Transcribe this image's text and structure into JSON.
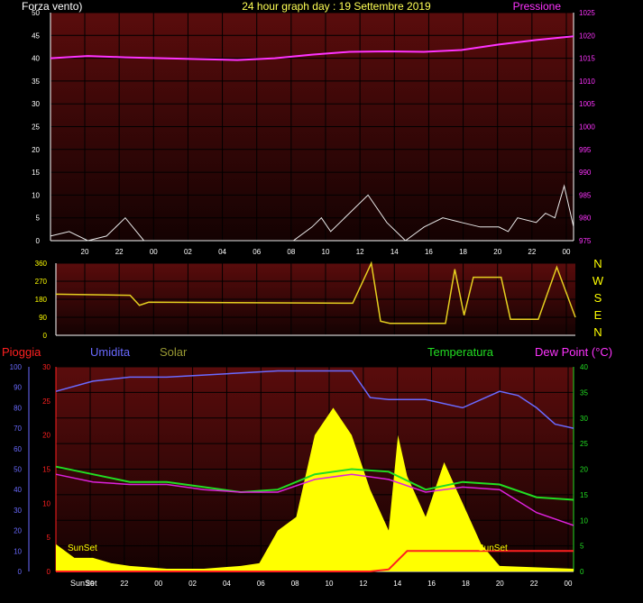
{
  "colors": {
    "bg": "#000000",
    "plot_top": "#5a0c0c",
    "plot_bottom": "#140202",
    "grid": "#000000",
    "axis": "#ffffff",
    "wind": "#e8e8e8",
    "gust": "#ffffff",
    "pressure": "#ff33ff",
    "direction": "#e6d020",
    "rain": "#ff2020",
    "humidity": "#6a6aff",
    "solar": "#ffff00",
    "temperature": "#22dd22",
    "dewpoint": "#dd22dd",
    "hour_text": "#ffffff"
  },
  "panel1": {
    "title": "24 hour graph day : 19 Settembre 2019",
    "left_label": "Forza vento)",
    "right_label": "Pressione",
    "left_ticks": [
      "0",
      "5",
      "10",
      "15",
      "20",
      "25",
      "30",
      "35",
      "40",
      "45",
      "50"
    ],
    "right_ticks": [
      "975",
      "980",
      "985",
      "990",
      "995",
      "1000",
      "1005",
      "1010",
      "1015",
      "1020",
      "1025"
    ]
  },
  "panel2": {
    "left_ticks": [
      "0",
      "90",
      "180",
      "270",
      "360"
    ],
    "compass": [
      "N",
      "W",
      "S",
      "E",
      "N"
    ]
  },
  "panel3": {
    "labels": {
      "rain": "Pioggia",
      "humidity": "Umidita",
      "solar": "Solar",
      "temperature": "Temperatura",
      "dewpoint": "Dew Point (°C)"
    },
    "humidity_ticks": [
      "0",
      "10",
      "20",
      "30",
      "40",
      "50",
      "60",
      "70",
      "80",
      "90",
      "100"
    ],
    "rain_ticks": [
      "0",
      "5",
      "10",
      "15",
      "20",
      "25",
      "30"
    ],
    "temp_ticks": [
      "0",
      "5",
      "10",
      "15",
      "20",
      "25",
      "30",
      "35",
      "40"
    ],
    "sunset_label": "SunSet",
    "sunset_label_bottom": "SunSet"
  },
  "hours": [
    "20",
    "22",
    "00",
    "02",
    "04",
    "06",
    "08",
    "10",
    "12",
    "14",
    "16",
    "18",
    "20",
    "22",
    "00"
  ],
  "chart_data": [
    {
      "type": "line",
      "title": "24 hour graph day : 19 Settembre 2019",
      "x_unit": "hours elapsed from start of 24h window",
      "xlim": [
        0,
        28
      ],
      "ylim_left": [
        0,
        50
      ],
      "ylim_right": [
        975,
        1025
      ],
      "series": [
        {
          "name": "Pressione",
          "axis": "right",
          "x": [
            0,
            2,
            4,
            6,
            8,
            10,
            12,
            14,
            16,
            18,
            20,
            22,
            24,
            26,
            28
          ],
          "values": [
            1015,
            1015.5,
            1015.2,
            1015,
            1014.8,
            1014.6,
            1015,
            1015.8,
            1016.4,
            1016.5,
            1016.4,
            1016.8,
            1018,
            1019,
            1019.8
          ]
        },
        {
          "name": "Forza vento)",
          "axis": "left",
          "x": [
            0,
            1,
            2,
            3,
            4,
            5,
            6,
            7,
            8,
            9,
            10,
            11,
            12,
            13,
            14,
            14.5,
            15,
            16,
            17,
            18,
            19,
            20,
            21,
            22,
            23,
            24,
            24.5,
            25,
            26,
            26.5,
            27,
            27.5,
            28
          ],
          "values": [
            1,
            2,
            0,
            1,
            5,
            0,
            0,
            0,
            0,
            0,
            0,
            0,
            0,
            0,
            3,
            5,
            2,
            6,
            10,
            4,
            0,
            3,
            5,
            4,
            3,
            3,
            2,
            5,
            4,
            6,
            5,
            12,
            3
          ]
        }
      ]
    },
    {
      "type": "line",
      "x_unit": "hours elapsed from start of 24h window",
      "xlim": [
        0,
        28
      ],
      "ylim": [
        0,
        360
      ],
      "series": [
        {
          "name": "Direzione",
          "x": [
            0,
            4,
            4.5,
            5,
            16,
            17,
            17.5,
            18,
            21,
            21.5,
            22,
            22.5,
            24,
            24.5,
            26,
            27,
            28
          ],
          "values": [
            205,
            200,
            150,
            165,
            160,
            360,
            70,
            60,
            60,
            330,
            100,
            290,
            290,
            80,
            80,
            340,
            90
          ]
        }
      ]
    },
    {
      "type": "line",
      "x_unit": "hours elapsed from start of 24h window",
      "xlim": [
        0,
        28
      ],
      "ylim_humidity": [
        0,
        100
      ],
      "ylim_rain": [
        0,
        30
      ],
      "ylim_temp": [
        0,
        40
      ],
      "series": [
        {
          "name": "Umidita",
          "axis": "humidity",
          "x": [
            0,
            2,
            4,
            6,
            8,
            10,
            12,
            14,
            16,
            17,
            18,
            20,
            22,
            24,
            25,
            26,
            27,
            28
          ],
          "values": [
            88,
            93,
            95,
            95,
            96,
            97,
            98,
            98,
            98,
            85,
            84,
            84,
            80,
            88,
            86,
            80,
            72,
            70
          ]
        },
        {
          "name": "Temperatura",
          "axis": "temp",
          "x": [
            0,
            2,
            4,
            6,
            8,
            10,
            12,
            14,
            16,
            18,
            20,
            22,
            24,
            26,
            28
          ],
          "values": [
            20.5,
            19,
            17.5,
            17.5,
            16.5,
            15.5,
            16,
            19,
            20,
            19.5,
            16,
            17.5,
            17,
            14.5,
            14
          ]
        },
        {
          "name": "Dew Point (°C)",
          "axis": "temp",
          "x": [
            0,
            2,
            4,
            6,
            8,
            10,
            12,
            14,
            16,
            18,
            20,
            22,
            24,
            26,
            28
          ],
          "values": [
            19,
            17.5,
            17,
            17,
            16,
            15.5,
            15.5,
            18,
            19,
            18,
            15.5,
            16.5,
            16,
            11.5,
            9
          ]
        },
        {
          "name": "Solar",
          "axis": "rain",
          "x": [
            0,
            1,
            2,
            3,
            4,
            6,
            8,
            10,
            11,
            12,
            13,
            14,
            15,
            16,
            17,
            18,
            18.5,
            19,
            20,
            21,
            22,
            23,
            24,
            28
          ],
          "values": [
            1,
            0.5,
            0.5,
            0.3,
            0.2,
            0.1,
            0.1,
            0.2,
            0.3,
            1.5,
            2,
            5,
            6,
            5,
            3,
            1.5,
            5,
            3.5,
            2,
            4,
            2.5,
            1,
            0.2,
            0.1
          ]
        },
        {
          "name": "Pioggia",
          "axis": "rain",
          "x": [
            0,
            6,
            10,
            14,
            17,
            18,
            19,
            28
          ],
          "values": [
            0,
            0,
            0,
            0,
            0,
            0.3,
            3,
            3
          ]
        }
      ]
    }
  ]
}
